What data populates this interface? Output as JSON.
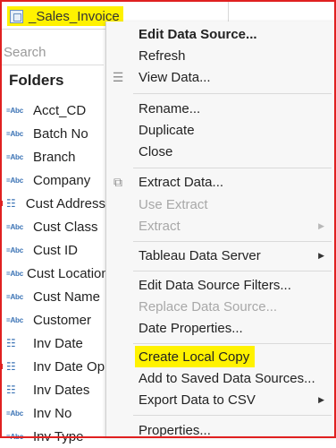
{
  "datasource": {
    "name": "_Sales_Invoice",
    "icon": "datasource-icon"
  },
  "search": {
    "placeholder": "Search"
  },
  "folders_heading": "Folders",
  "fields": [
    {
      "name": "Acct_CD",
      "type_icon": "=Abc"
    },
    {
      "name": "Batch No",
      "type_icon": "=Abc"
    },
    {
      "name": "Branch",
      "type_icon": "=Abc"
    },
    {
      "name": "Company",
      "type_icon": "=Abc"
    },
    {
      "name": "Cust Address",
      "type_icon": "hierarchy-icon"
    },
    {
      "name": "Cust Class",
      "type_icon": "=Abc"
    },
    {
      "name": "Cust ID",
      "type_icon": "=Abc"
    },
    {
      "name": "Cust Location",
      "type_icon": "=Abc"
    },
    {
      "name": "Cust Name",
      "type_icon": "=Abc"
    },
    {
      "name": "Customer",
      "type_icon": "=Abc"
    },
    {
      "name": "Inv Date",
      "type_icon": "calendar-icon"
    },
    {
      "name": "Inv Date Op",
      "type_icon": "hierarchy-icon"
    },
    {
      "name": "Inv Dates",
      "type_icon": "calendar-icon"
    },
    {
      "name": "Inv No",
      "type_icon": "=Abc"
    },
    {
      "name": "Inv Type",
      "type_icon": "=Abc"
    }
  ],
  "menu": {
    "edit_data_source": "Edit Data Source...",
    "refresh": "Refresh",
    "view_data": "View Data...",
    "rename": "Rename...",
    "duplicate": "Duplicate",
    "close": "Close",
    "extract_data": "Extract Data...",
    "use_extract": "Use Extract",
    "extract": "Extract",
    "tableau_data_server": "Tableau Data Server",
    "edit_filters": "Edit Data Source Filters...",
    "replace_data_source": "Replace Data Source...",
    "date_properties": "Date Properties...",
    "create_local_copy": "Create Local Copy",
    "add_to_saved": "Add to Saved Data Sources...",
    "export_csv": "Export Data to CSV",
    "properties": "Properties..."
  },
  "colors": {
    "highlight": "#fff200",
    "frame": "#e02020",
    "field_icon": "#3b73b5"
  }
}
